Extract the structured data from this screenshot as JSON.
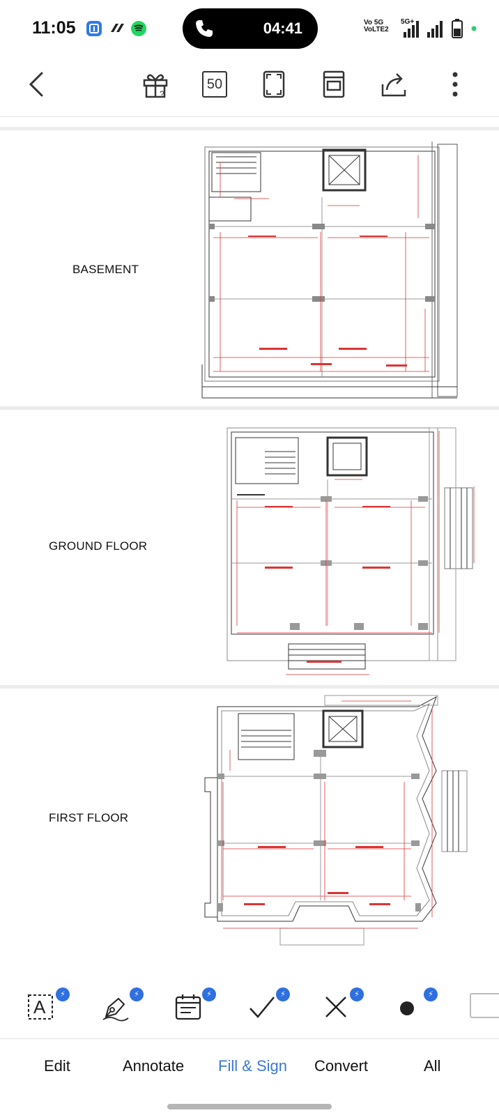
{
  "status_bar": {
    "time": "11:05",
    "call_timer": "04:41",
    "network_line1": "Vo 5G",
    "network_line2": "VoLTE2",
    "network_5g": "5G+",
    "icons": [
      "app-blue-icon",
      "app-link-icon",
      "spotify-icon",
      "phone-icon",
      "signal-icon",
      "battery-icon"
    ]
  },
  "toolbar": {
    "page_count": "50",
    "icons": [
      "back-icon",
      "gift-icon",
      "page-count",
      "fit-screen-icon",
      "layout-icon",
      "share-icon",
      "more-icon"
    ]
  },
  "document": {
    "pages": [
      {
        "label": "BASEMENT"
      },
      {
        "label": "GROUND FLOOR"
      },
      {
        "label": "FIRST FLOOR"
      }
    ]
  },
  "tools": {
    "items": [
      {
        "name": "text-box-icon",
        "label": "A"
      },
      {
        "name": "pen-icon"
      },
      {
        "name": "calendar-icon"
      },
      {
        "name": "check-icon"
      },
      {
        "name": "cross-icon"
      },
      {
        "name": "dot-icon"
      }
    ],
    "badge_symbol": "⚡"
  },
  "tabs": {
    "items": [
      {
        "label": "Edit"
      },
      {
        "label": "Annotate"
      },
      {
        "label": "Fill & Sign"
      },
      {
        "label": "Convert"
      },
      {
        "label": "All"
      }
    ],
    "active": "Fill & Sign",
    "active_color": "#3a78d8"
  }
}
